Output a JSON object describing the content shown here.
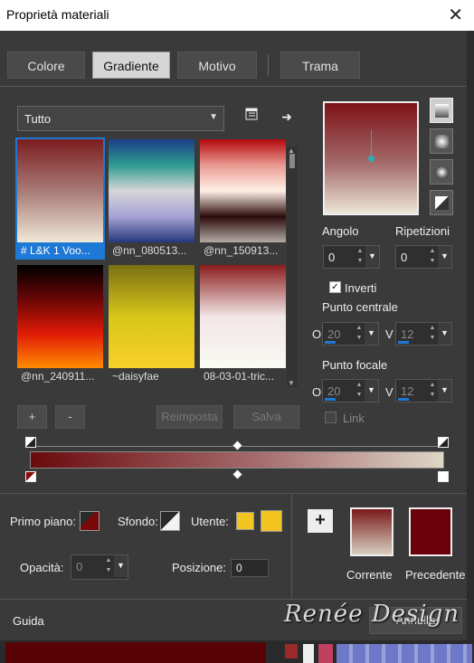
{
  "window": {
    "title": "Proprietà materiali",
    "close_icon": "close-icon"
  },
  "tabs": [
    {
      "label": "Colore",
      "active": false
    },
    {
      "label": "Gradiente",
      "active": true
    },
    {
      "label": "Motivo",
      "active": false
    },
    {
      "label": "Trama",
      "active": false
    }
  ],
  "category": {
    "value": "Tutto"
  },
  "gradients": [
    {
      "label": "# L&K 1 Voo...",
      "colors": [
        "#7b1d1f",
        "#a87a76",
        "#efe8d6"
      ],
      "selected": true
    },
    {
      "label": "@nn_080513...",
      "colors": [
        "#1d3f8a",
        "#2e9a8e",
        "#d6d6d6",
        "#a7a2d6",
        "#24377c"
      ],
      "selected": false
    },
    {
      "label": "@nn_150913...",
      "colors": [
        "#b4080c",
        "#e89890",
        "#fff1e6",
        "#2b0a0a",
        "#b2aaa6"
      ],
      "selected": false
    },
    {
      "label": "@nn_240911...",
      "colors": [
        "#000000",
        "#6b0606",
        "#e01a06",
        "#ff8c00"
      ],
      "selected": false
    },
    {
      "label": "~daisyfae",
      "colors": [
        "#7a6f12",
        "#d8c61a",
        "#f8d02a"
      ],
      "selected": false
    },
    {
      "label": "08-03-01-tric...",
      "colors": [
        "#8a1c1c",
        "#f2e6e6",
        "#fafaf4"
      ],
      "selected": false
    }
  ],
  "buttons": {
    "add": "+",
    "remove": "-",
    "reset": "Reimposta",
    "save": "Salva",
    "cancel": "Annulla"
  },
  "angle": {
    "label": "Angolo",
    "value": "0"
  },
  "repeats": {
    "label": "Ripetizioni",
    "value": "0"
  },
  "invert": {
    "label": "Inverti",
    "checked": true
  },
  "center_point": {
    "label": "Punto centrale",
    "o_label": "O",
    "o_value": "20",
    "v_label": "V",
    "v_value": "12"
  },
  "focal_point": {
    "label": "Punto focale",
    "o_label": "O",
    "o_value": "20",
    "v_label": "V",
    "v_value": "12"
  },
  "link": {
    "label": "Link",
    "checked": false
  },
  "bottom": {
    "foreground_label": "Primo piano:",
    "background_label": "Sfondo:",
    "user_label": "Utente:",
    "opacity_label": "Opacità:",
    "opacity_value": "0",
    "position_label": "Posizione:",
    "position_value": "0",
    "current_label": "Corrente",
    "previous_label": "Precedente",
    "user_color": "#f3c421",
    "previous_color": "#6a0009"
  },
  "footer": {
    "guide": "Guida",
    "watermark": "Renée Design"
  }
}
